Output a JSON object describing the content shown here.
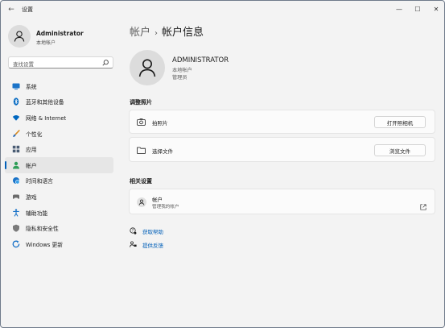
{
  "window": {
    "title": "设置"
  },
  "titlebar": {
    "back": "←",
    "minimize": "—",
    "maximize": "☐",
    "close": "✕"
  },
  "profile": {
    "name": "Administrator",
    "type": "本地帐户"
  },
  "search": {
    "placeholder": "查找设置"
  },
  "nav": [
    {
      "label": "系统",
      "icon": "display-icon",
      "color": "#1a73c8"
    },
    {
      "label": "蓝牙和其他设备",
      "icon": "bluetooth-icon",
      "color": "#0067c0"
    },
    {
      "label": "网络 & Internet",
      "icon": "wifi-icon",
      "color": "#0067c0"
    },
    {
      "label": "个性化",
      "icon": "brush-icon",
      "color": "#d88a1e"
    },
    {
      "label": "应用",
      "icon": "apps-icon",
      "color": "#4a5c73"
    },
    {
      "label": "帐户",
      "icon": "person-icon",
      "color": "#2f9e58",
      "selected": true
    },
    {
      "label": "时间和语言",
      "icon": "globe-clock-icon",
      "color": "#1a73c8"
    },
    {
      "label": "游戏",
      "icon": "gamepad-icon",
      "color": "#6b6b6b"
    },
    {
      "label": "辅助功能",
      "icon": "accessibility-icon",
      "color": "#1a73c8"
    },
    {
      "label": "隐私和安全性",
      "icon": "shield-icon",
      "color": "#6b6b6b"
    },
    {
      "label": "Windows 更新",
      "icon": "update-icon",
      "color": "#1a73c8"
    }
  ],
  "breadcrumb": {
    "parent": "帐户",
    "separator": "›",
    "current": "帐户信息"
  },
  "account": {
    "name": "ADMINISTRATOR",
    "type": "本地帐户",
    "role": "管理员"
  },
  "photo_section": {
    "title": "调整照片",
    "camera": {
      "label": "拍照片",
      "button": "打开照相机"
    },
    "file": {
      "label": "选择文件",
      "button": "浏览文件"
    }
  },
  "related": {
    "title": "相关设置",
    "accounts": {
      "label": "帐户",
      "sub": "管理我的帐户"
    }
  },
  "links": {
    "help": "获取帮助",
    "feedback": "提供反馈"
  },
  "accent": "#005fb8"
}
